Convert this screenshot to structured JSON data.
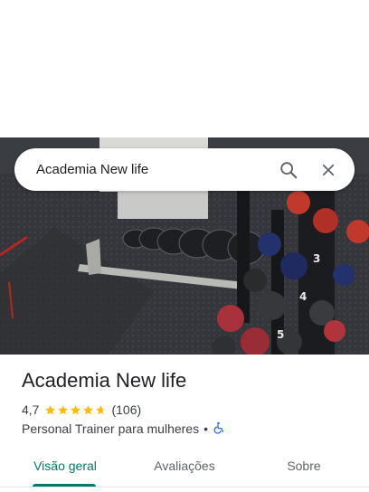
{
  "search": {
    "query": "Academia New life",
    "search_icon": "search-icon",
    "close_icon": "close-icon"
  },
  "place": {
    "name": "Academia New life",
    "rating": "4,7",
    "rating_value": 4.7,
    "review_count": "(106)",
    "category": "Personal Trainer para mulheres",
    "separator": "•",
    "accessibility_icon": "wheelchair-icon"
  },
  "tabs": [
    {
      "label": "Visão geral",
      "active": true
    },
    {
      "label": "Avaliações",
      "active": false
    },
    {
      "label": "Sobre",
      "active": false
    }
  ],
  "colors": {
    "accent": "#00796b",
    "star": "#fbbc04",
    "accessibility": "#1a73e8"
  }
}
